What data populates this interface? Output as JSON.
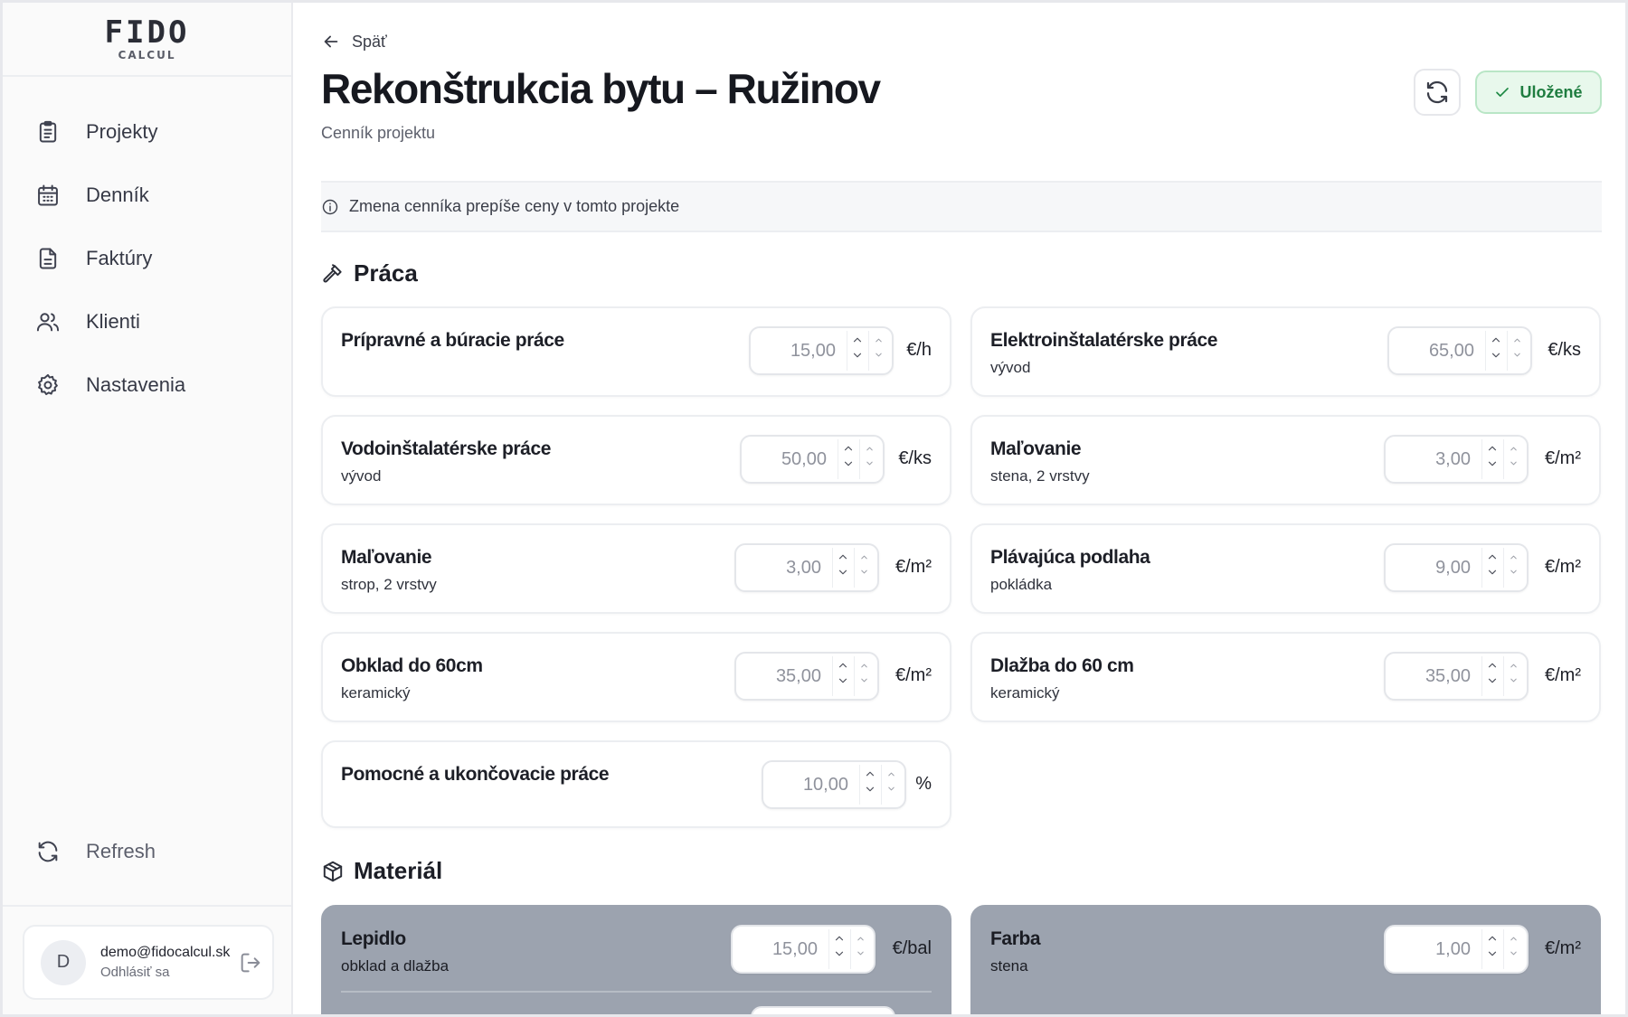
{
  "app": {
    "logo_main": "FIDO",
    "logo_sub": "CALCUL"
  },
  "sidebar": {
    "items": [
      {
        "label": "Projekty",
        "icon": "clipboard-icon"
      },
      {
        "label": "Denník",
        "icon": "calendar-icon"
      },
      {
        "label": "Faktúry",
        "icon": "document-icon"
      },
      {
        "label": "Klienti",
        "icon": "users-icon"
      },
      {
        "label": "Nastavenia",
        "icon": "gear-icon"
      }
    ],
    "refresh_label": "Refresh",
    "user": {
      "avatar_letter": "D",
      "email": "demo@fidocalcul.sk",
      "logout_label": "Odhlásiť sa"
    }
  },
  "header": {
    "back_label": "Späť",
    "title": "Rekonštrukcia bytu – Ružinov",
    "subtitle": "Cenník projektu",
    "saved_label": "Uložené"
  },
  "notice": {
    "text": "Zmena cenníka prepíše ceny v tomto projekte"
  },
  "sections": {
    "work": {
      "title": "Práca",
      "items": [
        {
          "name": "Prípravné a búracie práce",
          "desc": "",
          "value": "15,00",
          "unit": "€/h"
        },
        {
          "name": "Elektroinštalatérske práce",
          "desc": "vývod",
          "value": "65,00",
          "unit": "€/ks"
        },
        {
          "name": "Vodoinštalatérske práce",
          "desc": "vývod",
          "value": "50,00",
          "unit": "€/ks"
        },
        {
          "name": "Maľovanie",
          "desc": "stena, 2 vrstvy",
          "value": "3,00",
          "unit": "€/m²"
        },
        {
          "name": "Maľovanie",
          "desc": "strop, 2 vrstvy",
          "value": "3,00",
          "unit": "€/m²"
        },
        {
          "name": "Plávajúca podlaha",
          "desc": "pokládka",
          "value": "9,00",
          "unit": "€/m²"
        },
        {
          "name": "Obklad do 60cm",
          "desc": "keramický",
          "value": "35,00",
          "unit": "€/m²"
        },
        {
          "name": "Dlažba do 60 cm",
          "desc": "keramický",
          "value": "35,00",
          "unit": "€/m²"
        },
        {
          "name": "Pomocné a ukončovacie práce",
          "desc": "",
          "value": "10,00",
          "unit": "%"
        }
      ]
    },
    "material": {
      "title": "Materiál",
      "items": [
        {
          "name": "Lepidlo",
          "desc": "obklad a dlažba",
          "value": "15,00",
          "unit": "€/bal"
        },
        {
          "name": "Farba",
          "desc": "stena",
          "value": "1,00",
          "unit": "€/m²"
        }
      ]
    }
  }
}
